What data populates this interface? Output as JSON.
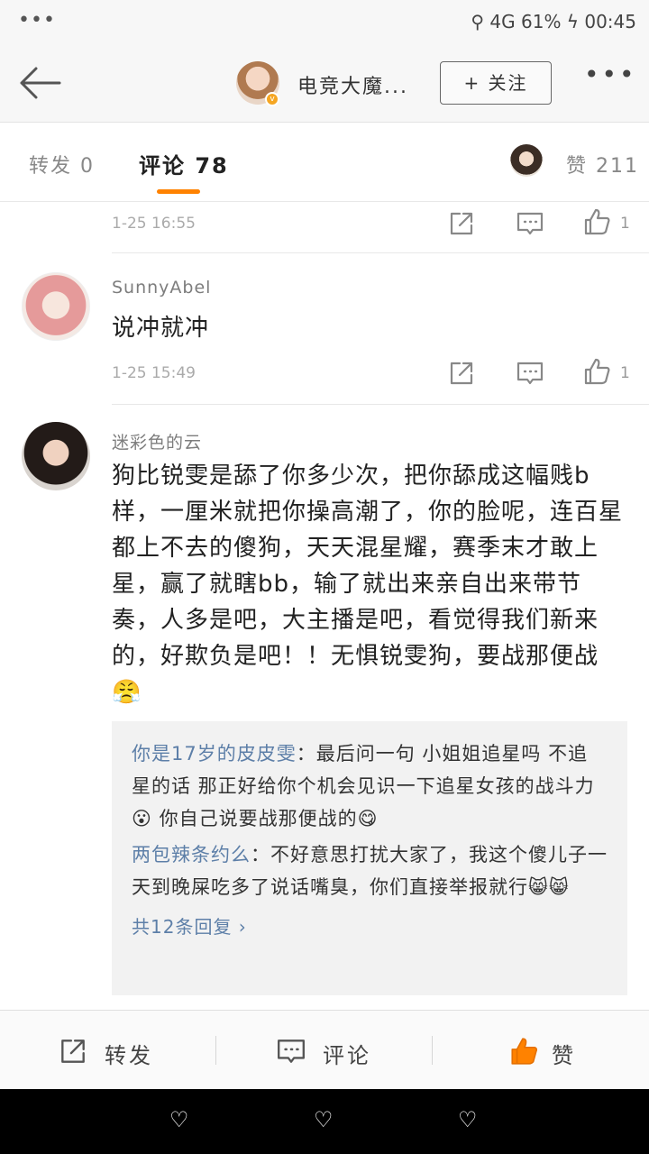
{
  "status_bar": {
    "dots": "•••",
    "right": "⚲ 4G 61% ϟ 00:45"
  },
  "header": {
    "back_icon": "arrow-left-icon",
    "title": "电竞大魔...",
    "verified_badge": "v",
    "follow_label": "+ 关注",
    "more": "•••"
  },
  "tabs": {
    "repost": "转发 0",
    "comment": "评论 78",
    "likes": "赞 211"
  },
  "comments": [
    {
      "time": "1-25 16:55",
      "like_count": "1"
    },
    {
      "user": "SunnyAbel",
      "text": "说冲就冲",
      "time": "1-25 15:49",
      "like_count": "1"
    },
    {
      "user": "迷彩色的云",
      "text": "狗比锐雯是舔了你多少次，把你舔成这幅贱b样，一厘米就把你操高潮了，你的脸呢，连百星都上不去的傻狗，天天混星耀，赛季末才敢上星，赢了就瞎bb，输了就出来亲自出来带节奏，人多是吧，大主播是吧，看觉得我们新来的，好欺负是吧！！无惧锐雯狗，要战那便战😤",
      "replies": [
        {
          "who": "你是17岁的皮皮雯",
          "text": "：最后问一句 小姐姐追星吗 不追星的话 那正好给你个机会见识一下追星女孩的战斗力😮 你自己说要战那便战的😋"
        },
        {
          "who": "两包辣条约么",
          "text": "：不好意思打扰大家了，我这个傻儿子一天到晚屎吃多了说话嘴臭，你们直接举报就行😸😸"
        }
      ],
      "more_replies": "共12条回复 ›"
    }
  ],
  "bottom_bar": {
    "repost": "转发",
    "comment": "评论",
    "like": "赞"
  },
  "nav_bar": {
    "buttons": [
      "♡",
      "♡",
      "♡"
    ]
  },
  "colors": {
    "accent": "#ff8200",
    "link": "#5d7fa8"
  }
}
